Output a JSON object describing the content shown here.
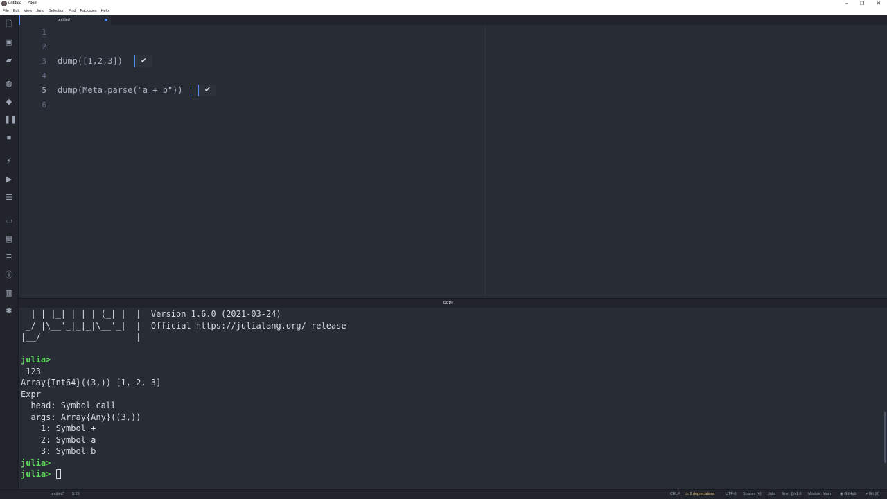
{
  "window": {
    "title": "untitled — Atom",
    "minimize": "–",
    "maximize": "❐",
    "close": "✕"
  },
  "menu": [
    "File",
    "Edit",
    "View",
    "Juno",
    "Selection",
    "Find",
    "Packages",
    "Help"
  ],
  "toolbar": {
    "icons": [
      "new-file-icon",
      "save-icon",
      "open-folder-icon",
      "globe-icon",
      "eraser-icon",
      "pause-icon",
      "stop-icon",
      "bolt-icon",
      "play-icon",
      "list-icon",
      "terminal-icon",
      "book-icon",
      "bullet-list-icon",
      "info-icon",
      "bar-chart-icon",
      "bug-icon"
    ]
  },
  "tab": {
    "title": "untitled"
  },
  "editor": {
    "line_numbers": [
      "1",
      "2",
      "3",
      "4",
      "5",
      "6"
    ],
    "lines": [
      "",
      "",
      "dump([1,2,3])",
      "",
      "dump(Meta.parse(\"a + b\"))",
      ""
    ],
    "result_mark": "✔"
  },
  "repl": {
    "header": "REPL",
    "banner": [
      "  | | |_| | | | (_| |  |  Version 1.6.0 (2021-03-24)",
      " _/ |\\__'_|_|_|\\__'_|  |  Official https://julialang.org/ release",
      "|__/                   |"
    ],
    "prompt": "julia>",
    "output": [
      " 123",
      "Array{Int64}((3,)) [1, 2, 3]",
      "Expr",
      "  head: Symbol call",
      "  args: Array{Any}((3,))",
      "    1: Symbol +",
      "    2: Symbol a",
      "    3: Symbol b"
    ]
  },
  "status": {
    "file": "untitled*",
    "position": "5:26",
    "line_ending": "CRLF",
    "deprecations": "⚠ 2 deprecations",
    "encoding": "UTF-8",
    "indent": "Spaces (4)",
    "grammar": "Julia",
    "env": "Env: @v1.6",
    "module": "Module: Main",
    "github": "GitHub",
    "git": "Git (0)"
  }
}
